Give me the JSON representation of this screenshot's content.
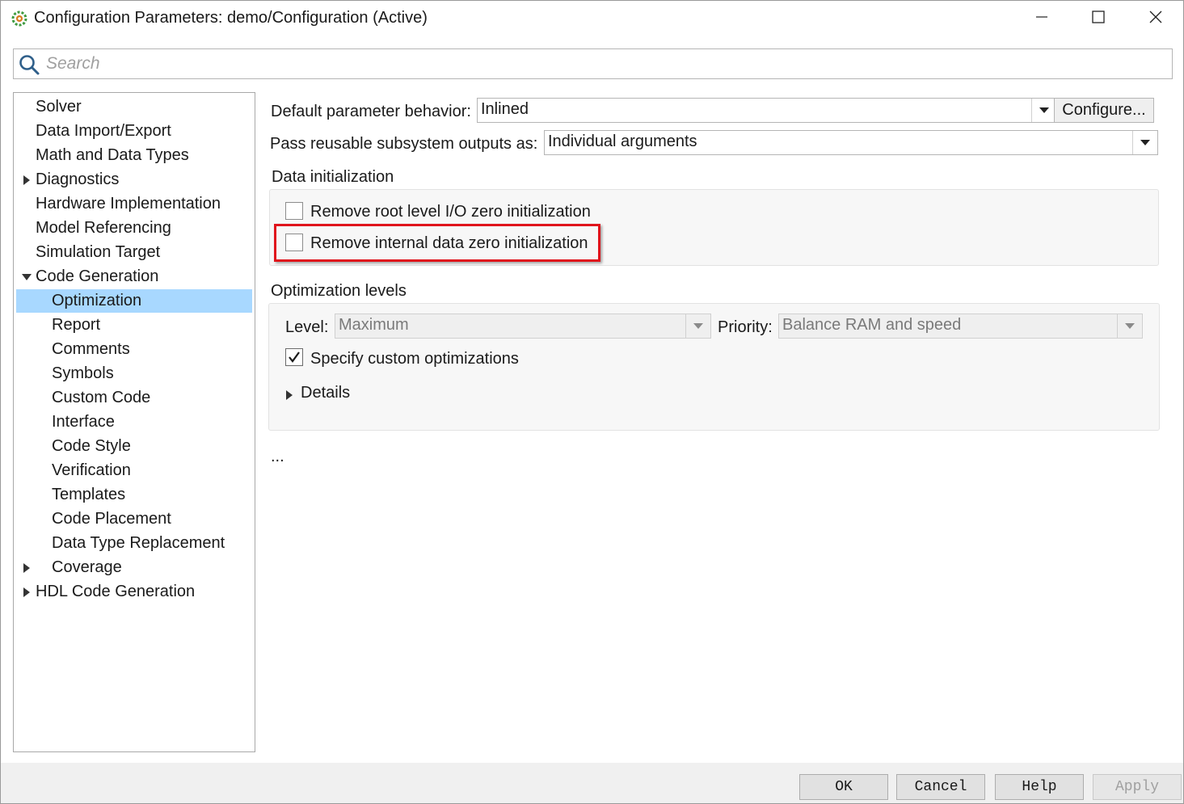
{
  "window": {
    "title": "Configuration Parameters: demo/Configuration (Active)",
    "icons": {
      "app": "simulink-gear-icon",
      "minimize": "minimize-icon",
      "maximize": "maximize-icon",
      "close": "close-icon"
    }
  },
  "search": {
    "placeholder": "Search",
    "value": ""
  },
  "tree": {
    "items": [
      {
        "label": "Solver",
        "expander": "none",
        "selected": false
      },
      {
        "label": "Data Import/Export",
        "expander": "none",
        "selected": false
      },
      {
        "label": "Math and Data Types",
        "expander": "none",
        "selected": false
      },
      {
        "label": "Diagnostics",
        "expander": "collapsed",
        "selected": false
      },
      {
        "label": "Hardware Implementation",
        "expander": "none",
        "selected": false
      },
      {
        "label": "Model Referencing",
        "expander": "none",
        "selected": false
      },
      {
        "label": "Simulation Target",
        "expander": "none",
        "selected": false
      },
      {
        "label": "Code Generation",
        "expander": "expanded",
        "selected": false
      },
      {
        "label": "Optimization",
        "expander": "none",
        "selected": true
      },
      {
        "label": "Report",
        "expander": "none",
        "selected": false
      },
      {
        "label": "Comments",
        "expander": "none",
        "selected": false
      },
      {
        "label": "Symbols",
        "expander": "none",
        "selected": false
      },
      {
        "label": "Custom Code",
        "expander": "none",
        "selected": false
      },
      {
        "label": "Interface",
        "expander": "none",
        "selected": false
      },
      {
        "label": "Code Style",
        "expander": "none",
        "selected": false
      },
      {
        "label": "Verification",
        "expander": "none",
        "selected": false
      },
      {
        "label": "Templates",
        "expander": "none",
        "selected": false
      },
      {
        "label": "Code Placement",
        "expander": "none",
        "selected": false
      },
      {
        "label": "Data Type Replacement",
        "expander": "none",
        "selected": false
      },
      {
        "label": "Coverage",
        "expander": "collapsed",
        "selected": false
      },
      {
        "label": "HDL Code Generation",
        "expander": "collapsed",
        "selected": false
      }
    ]
  },
  "params": {
    "default_param_label": "Default parameter behavior:",
    "default_param_value": "Inlined",
    "configure_label": "Configure...",
    "pass_reusable_label": "Pass reusable subsystem outputs as:",
    "pass_reusable_value": "Individual arguments"
  },
  "data_init": {
    "heading": "Data initialization",
    "remove_root_label": "Remove root level I/O zero initialization",
    "remove_root_checked": false,
    "remove_internal_label": "Remove internal data zero initialization",
    "remove_internal_checked": false
  },
  "opt_levels": {
    "heading": "Optimization levels",
    "level_label": "Level:",
    "level_value": "Maximum",
    "priority_label": "Priority:",
    "priority_value": "Balance RAM and speed",
    "custom_label": "Specify custom optimizations",
    "custom_checked": true,
    "details_label": "Details"
  },
  "ellipsis": "...",
  "buttons": {
    "ok": "OK",
    "cancel": "Cancel",
    "help": "Help",
    "apply": "Apply"
  },
  "colors": {
    "selection": "#a8d8ff",
    "highlight": "#e0141c"
  }
}
